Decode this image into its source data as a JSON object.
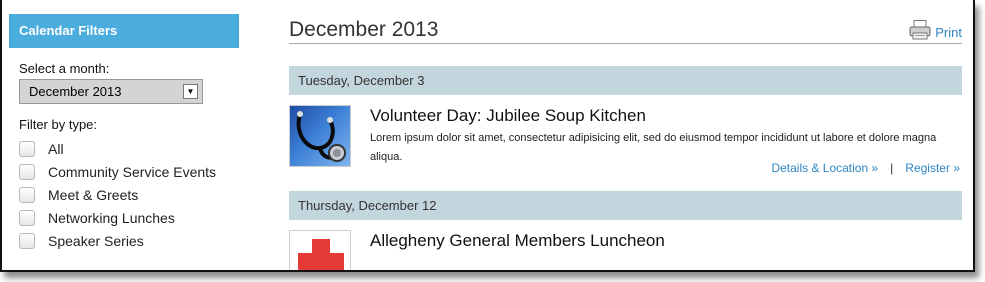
{
  "sidebar": {
    "header": "Calendar Filters",
    "month_label": "Select a month:",
    "month_value": "December 2013",
    "type_label": "Filter by type:",
    "types": [
      "All",
      "Community Service Events",
      "Meet & Greets",
      "Networking Lunches",
      "Speaker Series"
    ]
  },
  "main": {
    "title": "December 2013",
    "print_label": "Print",
    "days": [
      {
        "heading": "Tuesday, December 3",
        "events": [
          {
            "title": "Volunteer Day: Jubilee Soup Kitchen",
            "description": "Lorem ipsum dolor sit amet, consectetur adipisicing elit, sed do eiusmod tempor incididunt ut labore et dolore magna aliqua.",
            "details_link": "Details & Location »",
            "separator": "|",
            "register_link": "Register »"
          }
        ]
      },
      {
        "heading": "Thursday, December 12",
        "events": [
          {
            "title": "Allegheny General Members Luncheon"
          }
        ]
      }
    ]
  },
  "colors": {
    "sidebar_header_bg": "#4badde",
    "day_bar_bg": "#c4d6dd",
    "link": "#2f87c4",
    "cross": "#e53935"
  }
}
